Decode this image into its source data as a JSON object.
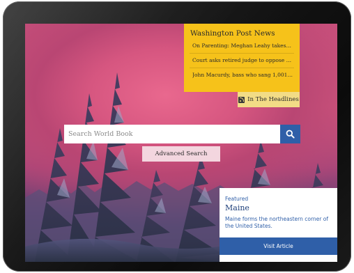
{
  "news": {
    "title": "Washington Post News",
    "items": [
      {
        "text": "On Parenting: Meghan Leahy takes y..."
      },
      {
        "text": "Court asks retired judge to oppose Ju..."
      },
      {
        "text": "John Macurdy, bass who sang 1,001 ti..."
      }
    ],
    "headlines_label": "In The Headlines",
    "headlines_icon": "rss-icon"
  },
  "search": {
    "placeholder": "Search World Book",
    "value": "",
    "button_icon": "search-icon",
    "advanced_label": "Advanced Search"
  },
  "featured": {
    "tag": "Featured",
    "title": "Maine",
    "description": "Maine forms the northeastern corner of the United States.",
    "visit_label": "Visit Article"
  },
  "colors": {
    "news_bg": "#f6c21a",
    "headlines_bg": "#f2dc86",
    "accent_blue": "#2f5fa8",
    "advanced_bg": "#f3d6df"
  }
}
